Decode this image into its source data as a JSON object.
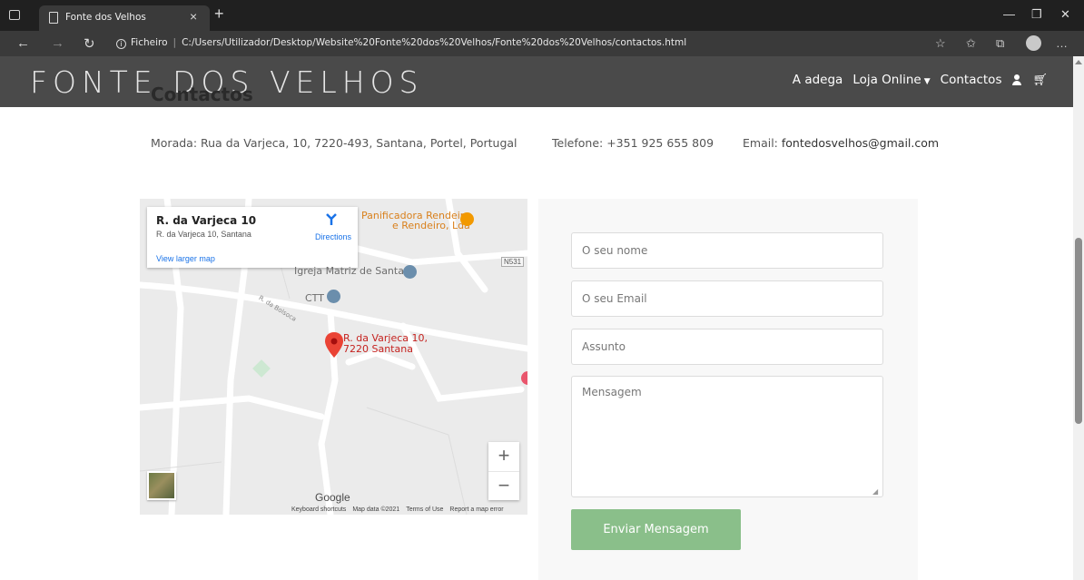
{
  "browser": {
    "tab_title": "Fonte dos Velhos",
    "tab_close": "×",
    "new_tab": "+",
    "url_prefix": "Ficheiro",
    "url_separator": "|",
    "url": "C:/Users/Utilizador/Desktop/Website%20Fonte%20dos%20Velhos/Fonte%20dos%20Velhos/contactos.html"
  },
  "site": {
    "logo": "FONTE DOS VELHOS",
    "nav": {
      "adega": "A adega",
      "loja": "Loja Online",
      "contactos": "Contactos"
    }
  },
  "page": {
    "heading": "Contactos",
    "address": "Morada: Rua da Varjeca, 10, 7220-493, Santana, Portel, Portugal",
    "phone": "Telefone: +351 925 655 809",
    "email_label": "Email: ",
    "email_value": "fontedosvelhos@gmail.com"
  },
  "map": {
    "place_title": "R. da Varjeca 10",
    "place_address": "R. da Varjeca 10, Santana",
    "directions": "Directions",
    "view_larger": "View larger map",
    "poi_bakery_line1": "Panificadora Rendeiro",
    "poi_bakery_line2": "e Rendeiro, Lda",
    "poi_church": "Igreja Matriz de Santana",
    "poi_ctt": "CTT",
    "road_label": "R. da Bolsoca",
    "road_shield": "N531",
    "pin_line1": "R. da Varjeca 10,",
    "pin_line2": "7220 Santana",
    "zoom_in": "+",
    "zoom_out": "−",
    "google": "Google",
    "footer": [
      "Keyboard shortcuts",
      "Map data ©2021",
      "Terms of Use",
      "Report a map error"
    ]
  },
  "form": {
    "name_placeholder": "O seu nome",
    "email_placeholder": "O seu Email",
    "subject_placeholder": "Assunto",
    "message_placeholder": "Mensagem",
    "submit": "Enviar Mensagem"
  },
  "colors": {
    "header_bg": "#4a4a4a",
    "button_bg": "#8abf8a",
    "pin_red": "#ea4335",
    "poi_orange": "#f29900",
    "poi_blue": "#6b8eac"
  }
}
